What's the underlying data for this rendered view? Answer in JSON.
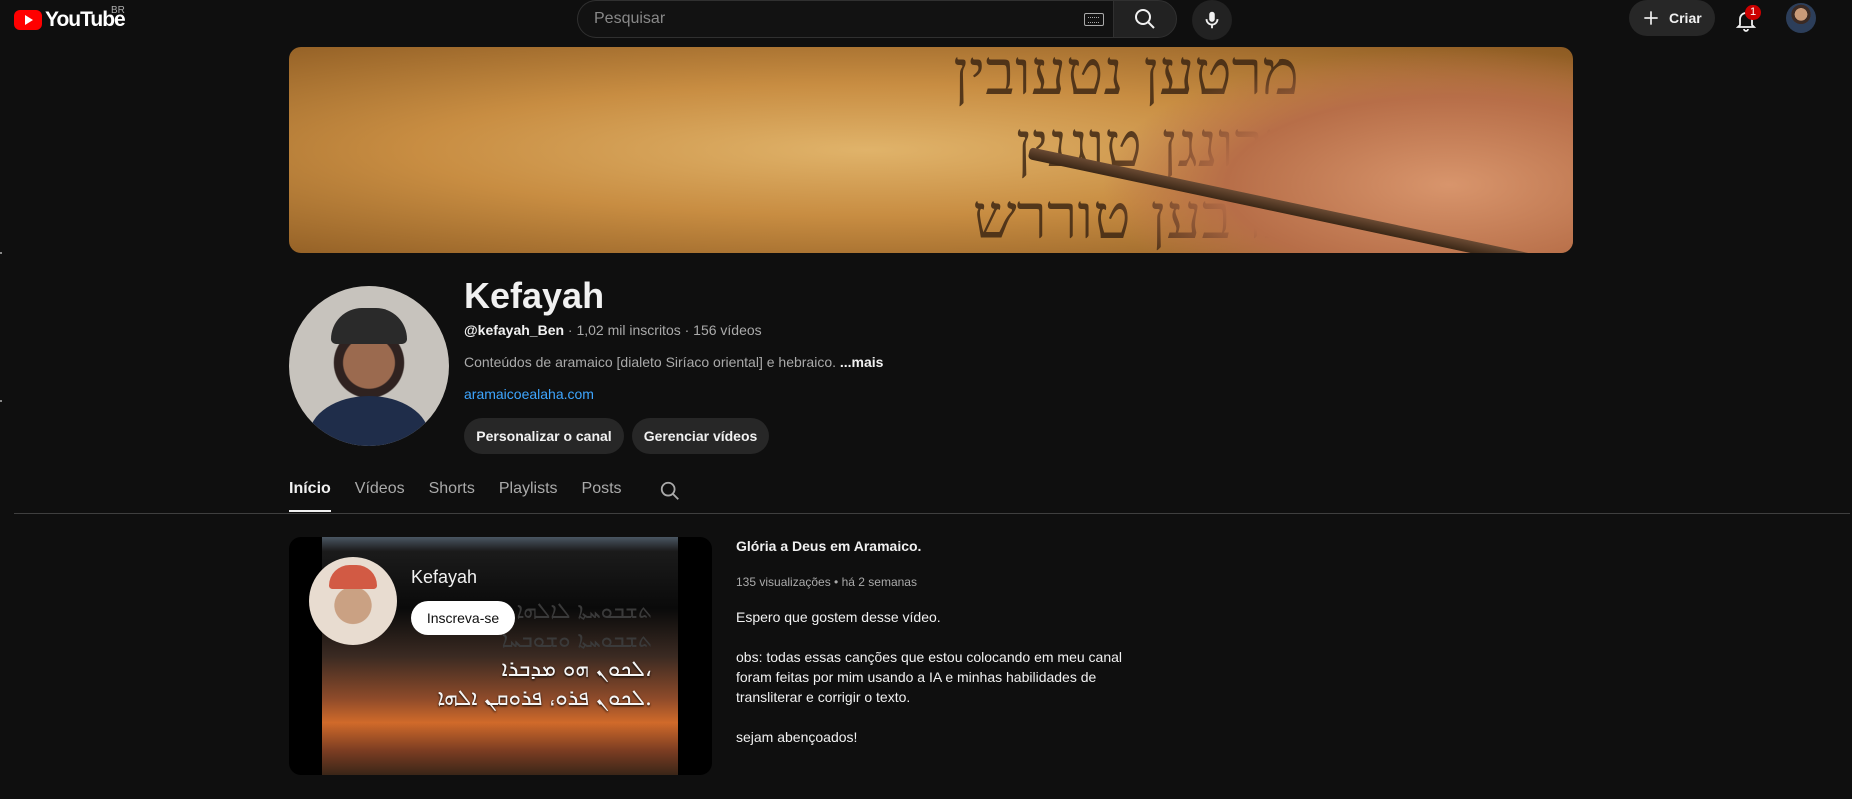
{
  "header": {
    "logo_text": "YouTube",
    "country": "BR",
    "search_placeholder": "Pesquisar",
    "create_label": "Criar",
    "notification_count": "1"
  },
  "channel": {
    "name": "Kefayah",
    "handle": "@kefayah_Ben",
    "meta_rest": " · 1,02 mil inscritos · 156 vídeos",
    "description": "Conteúdos de aramaico [dialeto Siríaco oriental] e hebraico. ",
    "more": "...mais",
    "link": "aramaicoealaha.com",
    "customize_button": "Personalizar o canal",
    "manage_button": "Gerenciar vídeos"
  },
  "banner": {
    "lines": [
      "מרטען נטעובין",
      "עבונגן טוגנין",
      "ארבען טוררש"
    ]
  },
  "tabs": [
    {
      "label": "Início",
      "active": true
    },
    {
      "label": "Vídeos",
      "active": false
    },
    {
      "label": "Shorts",
      "active": false
    },
    {
      "label": "Playlists",
      "active": false
    },
    {
      "label": "Posts",
      "active": false
    }
  ],
  "featured": {
    "player_channel": "Kefayah",
    "player_subscribe": "Inscreva-se",
    "aramaic_lines": [
      "ܬܫܒܘܚܬܐ ܠܐܠܗܐ",
      "ܬܫܒܘܚܬܐ ܘܫܘܒܚܐ",
      "ܠܟܘܢ ܗܘ ܡܕܒܪܐ،",
      "ܠܟܘܢ ܦܪܘ، ܦܪܘܩܢ ܐܠܗܐ."
    ],
    "title": "Glória a Deus em Aramaico.",
    "meta": "135 visualizações • há 2 semanas",
    "desc_1": "Espero que gostem desse vídeo.",
    "desc_2": "obs: todas essas canções que estou colocando em meu canal foram feitas por mim usando a IA e minhas habilidades de transliterar e corrigir o texto.",
    "desc_3": "sejam abençoados!"
  }
}
